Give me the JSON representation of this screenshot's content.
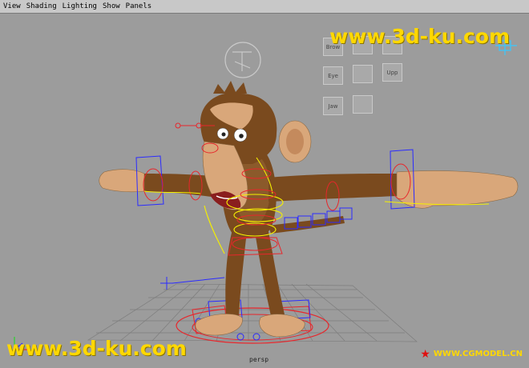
{
  "menubar": {
    "items": [
      "View",
      "Shading",
      "Lighting",
      "Show",
      "Panels"
    ]
  },
  "viewport": {
    "camera_label": "persp",
    "watermark_top": "www.3d-ku.com",
    "watermark_bottom": "www.3d-ku.com",
    "cgmodel_label": "WWW.CGMODEL.CN",
    "face_controls": [
      "Brow",
      "",
      "Eye",
      "",
      "Upp",
      "",
      "Jaw",
      ""
    ]
  },
  "colors": {
    "viewport_bg": "#9c9c9c",
    "watermark": "#ffd800",
    "rig_red": "#e8262b",
    "rig_blue": "#2b2bff",
    "rig_yellow": "#f5f000",
    "fur": "#7a4a1e",
    "skin": "#d9a77a"
  }
}
